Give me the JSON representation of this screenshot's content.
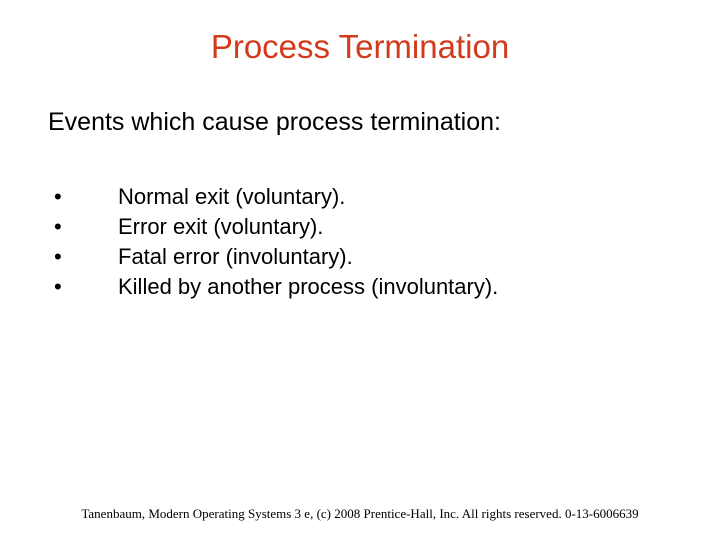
{
  "slide": {
    "title": "Process Termination",
    "subtitle": "Events which cause process termination:",
    "bullets": [
      "Normal exit (voluntary).",
      "Error exit (voluntary).",
      "Fatal error (involuntary).",
      "Killed by another process (involuntary)."
    ],
    "bullet_symbol": "•",
    "footer": "Tanenbaum, Modern Operating Systems 3 e, (c) 2008 Prentice-Hall, Inc. All rights reserved. 0-13-6006639"
  }
}
